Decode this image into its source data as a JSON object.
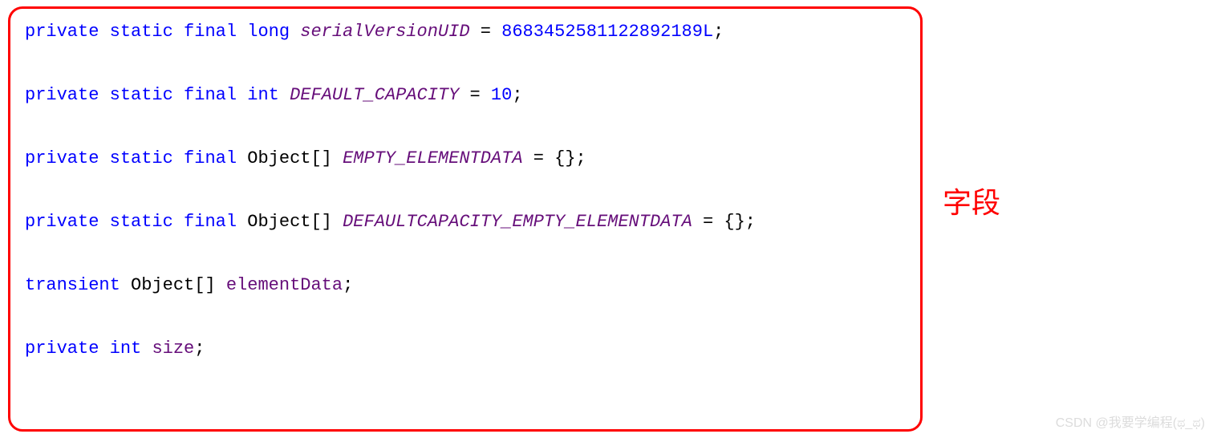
{
  "code": {
    "line1": {
      "kw1": "private",
      "kw2": "static",
      "kw3": "final",
      "kw4": "long",
      "name": "serialVersionUID",
      "eq": " = ",
      "val": "8683452581122892189L",
      "semi": ";"
    },
    "line2": {
      "kw1": "private",
      "kw2": "static",
      "kw3": "final",
      "kw4": "int",
      "name": "DEFAULT_CAPACITY",
      "eq": " = ",
      "val": "10",
      "semi": ";"
    },
    "line3": {
      "kw1": "private",
      "kw2": "static",
      "kw3": "final",
      "type": "Object[]",
      "name": "EMPTY_ELEMENTDATA",
      "rest": " = {};"
    },
    "line4": {
      "kw1": "private",
      "kw2": "static",
      "kw3": "final",
      "type": "Object[]",
      "name": "DEFAULTCAPACITY_EMPTY_ELEMENTDATA",
      "rest": " = {};"
    },
    "line5": {
      "kw1": "transient",
      "type": "Object[]",
      "name": "elementData",
      "semi": ";"
    },
    "line6": {
      "kw1": "private",
      "kw2": "int",
      "name": "size",
      "semi": ";"
    }
  },
  "annotation": "字段",
  "watermark": "CSDN @我要学编程(ಥ_ಥ)"
}
